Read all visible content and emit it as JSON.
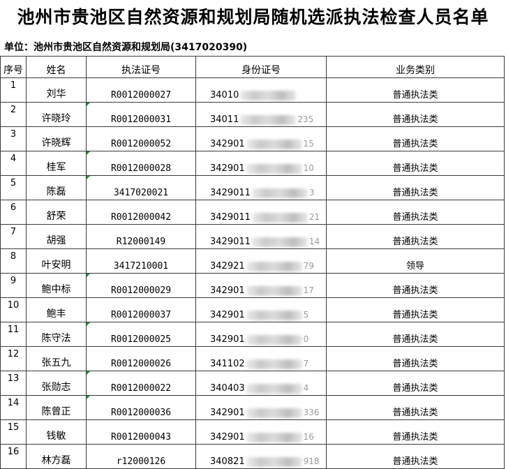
{
  "title": "池州市贵池区自然资源和规划局随机选派执法检查人员名单",
  "unit_line": "单位：池州市贵池区自然资源和规划局(3417020390)",
  "headers": {
    "seq": "序号",
    "name": "姓名",
    "cert": "执法证号",
    "id": "身份证号",
    "type": "业务类别"
  },
  "rows": [
    {
      "seq": "1",
      "name": "刘华",
      "cert": "R0012000027",
      "id_visible": "34010",
      "id_tail": "",
      "type": "普通执法类"
    },
    {
      "seq": "2",
      "name": "许晓玲",
      "cert": "R0012000031",
      "id_visible": "34011",
      "id_tail": "235",
      "type": "普通执法类"
    },
    {
      "seq": "3",
      "name": "许晓辉",
      "cert": "R0012000052",
      "id_visible": "342901",
      "id_tail": "15",
      "type": "普通执法类"
    },
    {
      "seq": "4",
      "name": "桂军",
      "cert": "R0012000028",
      "id_visible": "342901",
      "id_tail": "10",
      "type": "普通执法类"
    },
    {
      "seq": "5",
      "name": "陈磊",
      "cert": "3417020021",
      "id_visible": "3429011",
      "id_tail": "3",
      "type": "普通执法类"
    },
    {
      "seq": "6",
      "name": "舒荣",
      "cert": "R0012000042",
      "id_visible": "3429011",
      "id_tail": "21",
      "type": "普通执法类"
    },
    {
      "seq": "7",
      "name": "胡强",
      "cert": "R12000149",
      "id_visible": "3429011",
      "id_tail": "14",
      "type": "普通执法类"
    },
    {
      "seq": "8",
      "name": "叶安明",
      "cert": "3417210001",
      "id_visible": "342921",
      "id_tail": "79",
      "type": "领导"
    },
    {
      "seq": "9",
      "name": "鲍中标",
      "cert": "R0012000029",
      "id_visible": "342901",
      "id_tail": "17",
      "type": "普通执法类"
    },
    {
      "seq": "10",
      "name": "鲍丰",
      "cert": "R0012000037",
      "id_visible": "342901",
      "id_tail": "5",
      "type": "普通执法类"
    },
    {
      "seq": "11",
      "name": "陈守法",
      "cert": "R0012000025",
      "id_visible": "342901",
      "id_tail": "0",
      "type": "普通执法类"
    },
    {
      "seq": "12",
      "name": "张五九",
      "cert": "R0012000026",
      "id_visible": "341102",
      "id_tail": "7",
      "type": "普通执法类"
    },
    {
      "seq": "13",
      "name": "张勋志",
      "cert": "R0012000022",
      "id_visible": "340403",
      "id_tail": "4",
      "type": "普通执法类"
    },
    {
      "seq": "14",
      "name": "陈曾正",
      "cert": "R0012000036",
      "id_visible": "342901",
      "id_tail": "336",
      "type": "普通执法类"
    },
    {
      "seq": "15",
      "name": "钱敏",
      "cert": "R0012000043",
      "id_visible": "342901",
      "id_tail": "16",
      "type": "普通执法类"
    },
    {
      "seq": "16",
      "name": "林方磊",
      "cert": "r12000126",
      "id_visible": "340821",
      "id_tail": "918",
      "type": "普通执法类"
    }
  ],
  "colors": {
    "grid_line": "#3a3a3a",
    "comment_marker": "#1f8a3a"
  }
}
